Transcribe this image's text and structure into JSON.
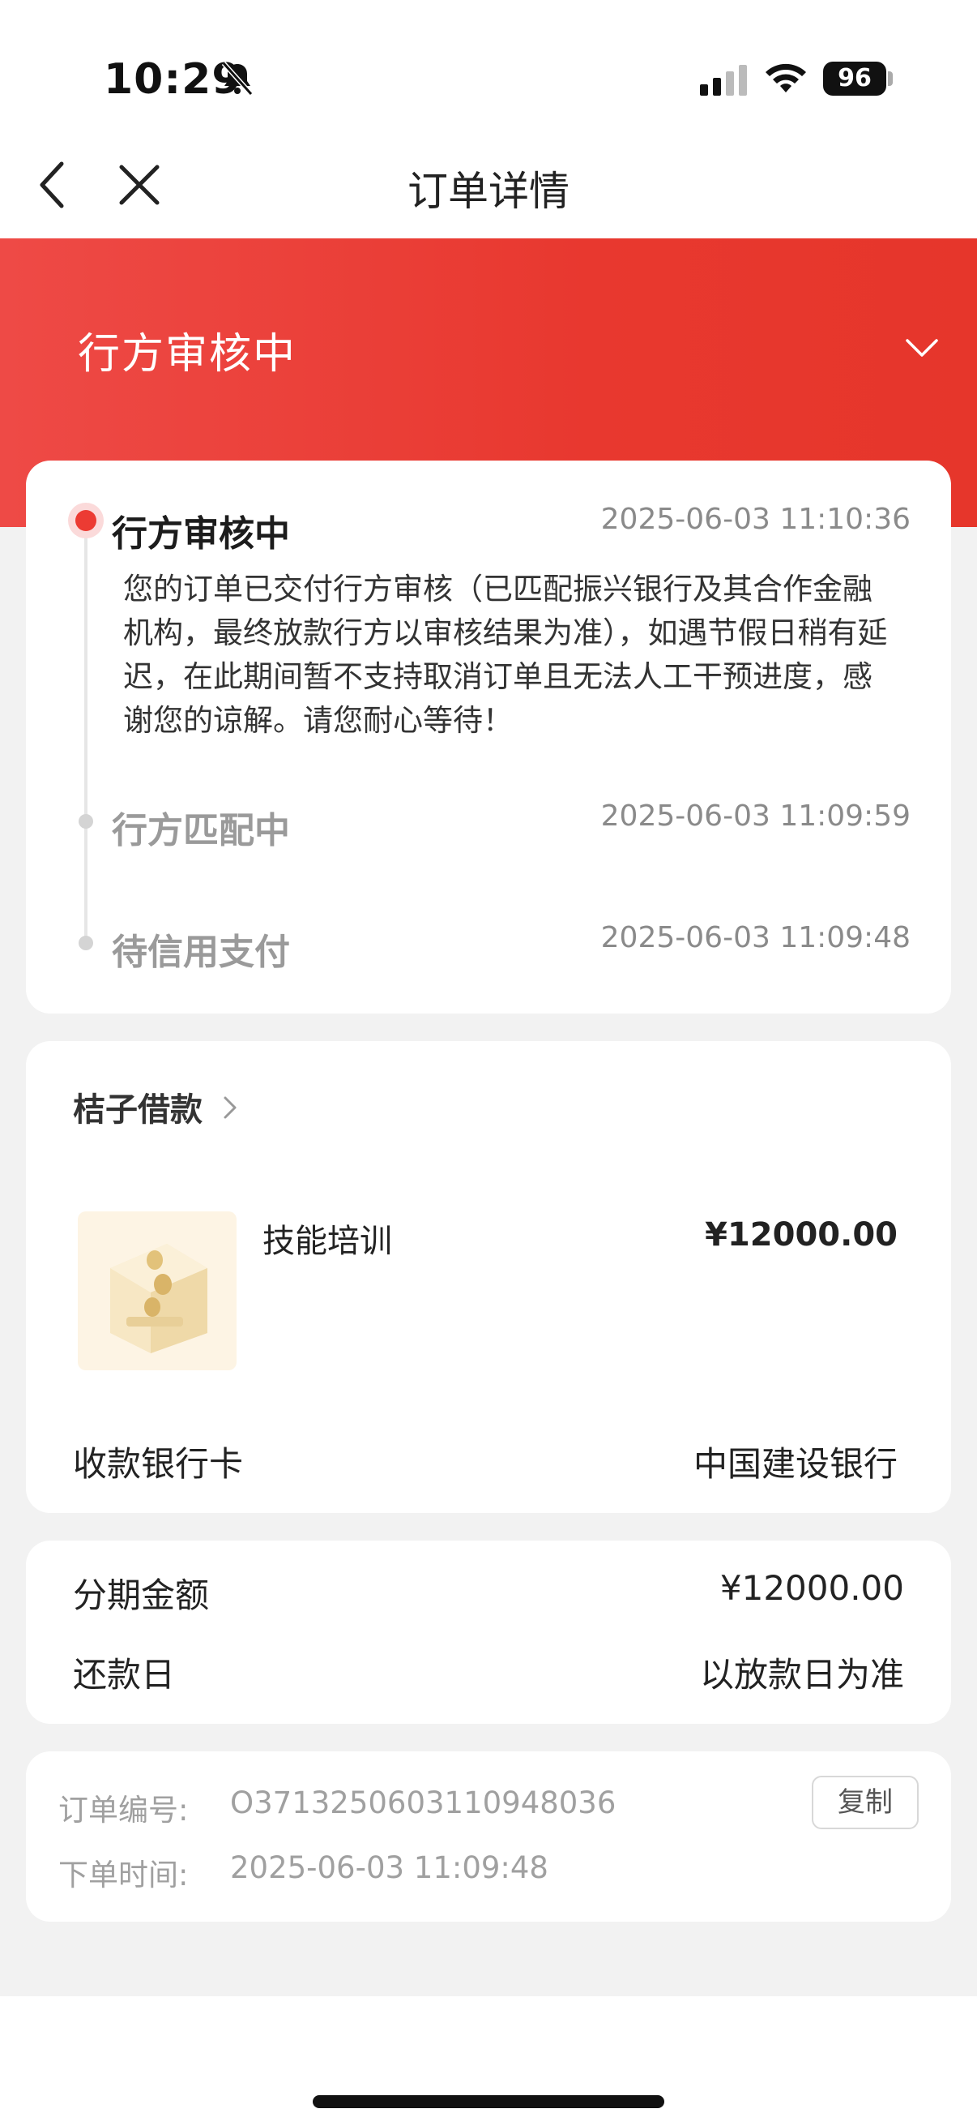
{
  "status_bar": {
    "time": "10:29",
    "battery": "96"
  },
  "nav": {
    "title": "订单详情"
  },
  "header": {
    "status": "行方审核中"
  },
  "timeline": [
    {
      "title": "行方审核中",
      "time": "2025-06-03 11:10:36",
      "desc": "您的订单已交付行方审核（已匹配振兴银行及其合作金融机构，最终放款行方以审核结果为准），如遇节假日稍有延迟，在此期间暂不支持取消订单且无法人工干预进度，感谢您的谅解。请您耐心等待！"
    },
    {
      "title": "行方匹配中",
      "time": "2025-06-03 11:09:59"
    },
    {
      "title": "待信用支付",
      "time": "2025-06-03 11:09:48"
    }
  ],
  "product_card": {
    "merchant": "桔子借款",
    "product_name": "技能培训",
    "price": "¥12000.00",
    "bank_label": "收款银行卡",
    "bank_value": "中国建设银行"
  },
  "installment": {
    "amount_label": "分期金额",
    "amount_value": "¥12000.00",
    "repay_label": "还款日",
    "repay_value": "以放款日为准"
  },
  "order_meta": {
    "order_no_label": "订单编号:",
    "order_no": "O3713250603110948036",
    "copy_label": "复制",
    "order_time_label": "下单时间:",
    "order_time": "2025-06-03 11:09:48"
  },
  "colors": {
    "accent": "#e8382f",
    "card": "#ffffff",
    "background": "#f2f2f2"
  }
}
